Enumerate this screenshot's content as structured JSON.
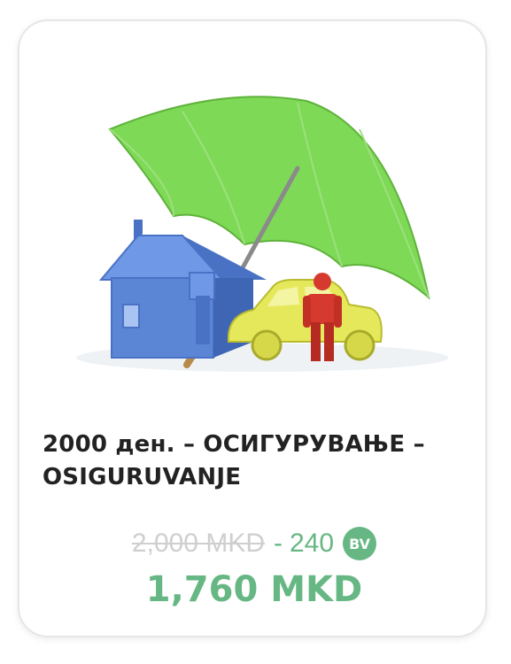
{
  "product": {
    "image_alt": "umbrella-house-car-person-illustration",
    "title": "2000 ден. – ОСИГУРУВАЊЕ – OSIGURUVANJE",
    "old_price": "2,000 MKD",
    "separator": "-",
    "discount": "240",
    "badge": "BV",
    "final_price": "1,760 MKD"
  },
  "colors": {
    "accent": "#66b783",
    "old_price": "#cfcfcf",
    "title": "#222222",
    "umbrella": "#7ed957",
    "house": "#5b86d6",
    "car": "#e6e85c",
    "person": "#d63a2f"
  }
}
